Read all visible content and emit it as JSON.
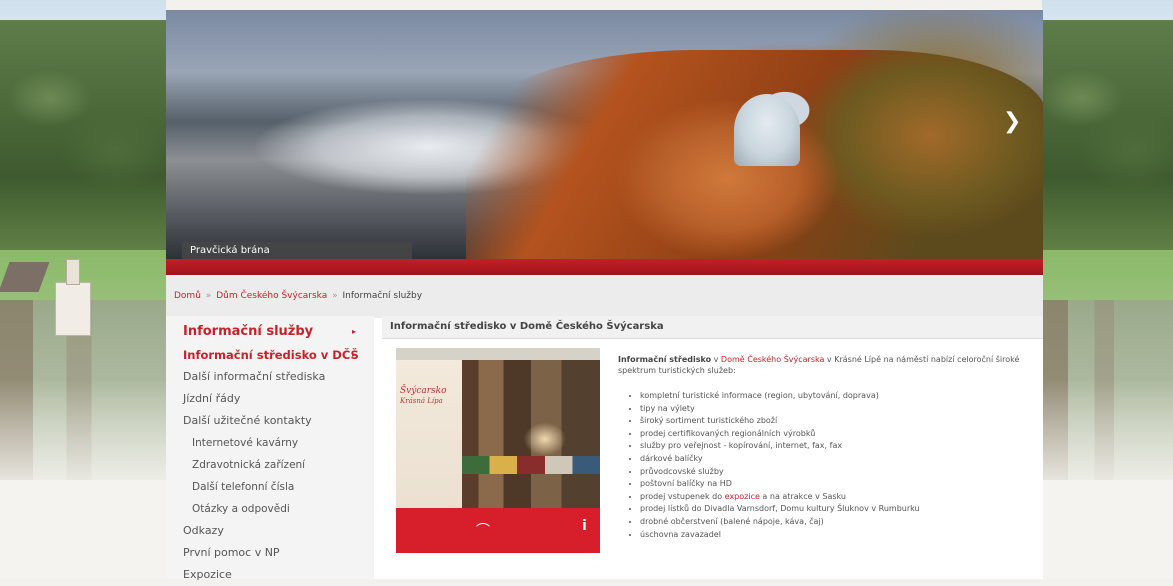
{
  "banner": {
    "caption": "Pravčická brána",
    "next_icon": "chevron-right-icon"
  },
  "breadcrumb": {
    "home": "Domů",
    "sep1": "»",
    "house": "Dům Českého Švýcarska",
    "sep2": "»",
    "current": "Informační služby"
  },
  "sidebar": {
    "items": [
      {
        "label": "Informační služby",
        "arrow": "▸"
      },
      {
        "label": "Informační středisko v DČŠ",
        "arrow": "▸"
      },
      {
        "label": "Další informační střediska"
      },
      {
        "label": "Jízdní řády"
      },
      {
        "label": "Další užitečné kontakty"
      },
      {
        "label": "Internetové kavárny"
      },
      {
        "label": "Zdravotnická zařízení"
      },
      {
        "label": "Další telefonní čísla"
      },
      {
        "label": "Otázky a odpovědi"
      },
      {
        "label": "Odkazy"
      },
      {
        "label": "První pomoc v NP"
      },
      {
        "label": "Expozice"
      }
    ]
  },
  "content": {
    "title": "Informační středisko v Domě Českého Švýcarska",
    "photo": {
      "panel_title": "Švýcarsko",
      "panel_subtitle": "Krásná Lípa"
    },
    "lead_bold": "Informační středisko",
    "lead_in": " v ",
    "lead_link": "Domě Českého Švýcarska",
    "lead_rest": " v Krásné Lípě na náměstí nabízí celoroční široké spektrum turistických služeb:",
    "bullets": [
      "kompletní turistické informace (region, ubytování, doprava)",
      "tipy na výlety",
      "široký sortiment turistického zboží",
      "prodej certifikovaných regionálních výrobků",
      "služby pro veřejnost - kopírování, internet, fax, fax",
      "dárkové balíčky",
      "průvodcovské služby",
      "poštovní balíčky na HD",
      "prodej vstupenek do expozice a na atrakce v Sasku",
      "prodej lístků do Divadla Varnsdorf, Domu kultury Šluknov v Rumburku",
      "drobné občerstvení (balené nápoje, káva, čaj)",
      "úschovna zavazadel"
    ],
    "bullet_link_word": "expozice"
  }
}
